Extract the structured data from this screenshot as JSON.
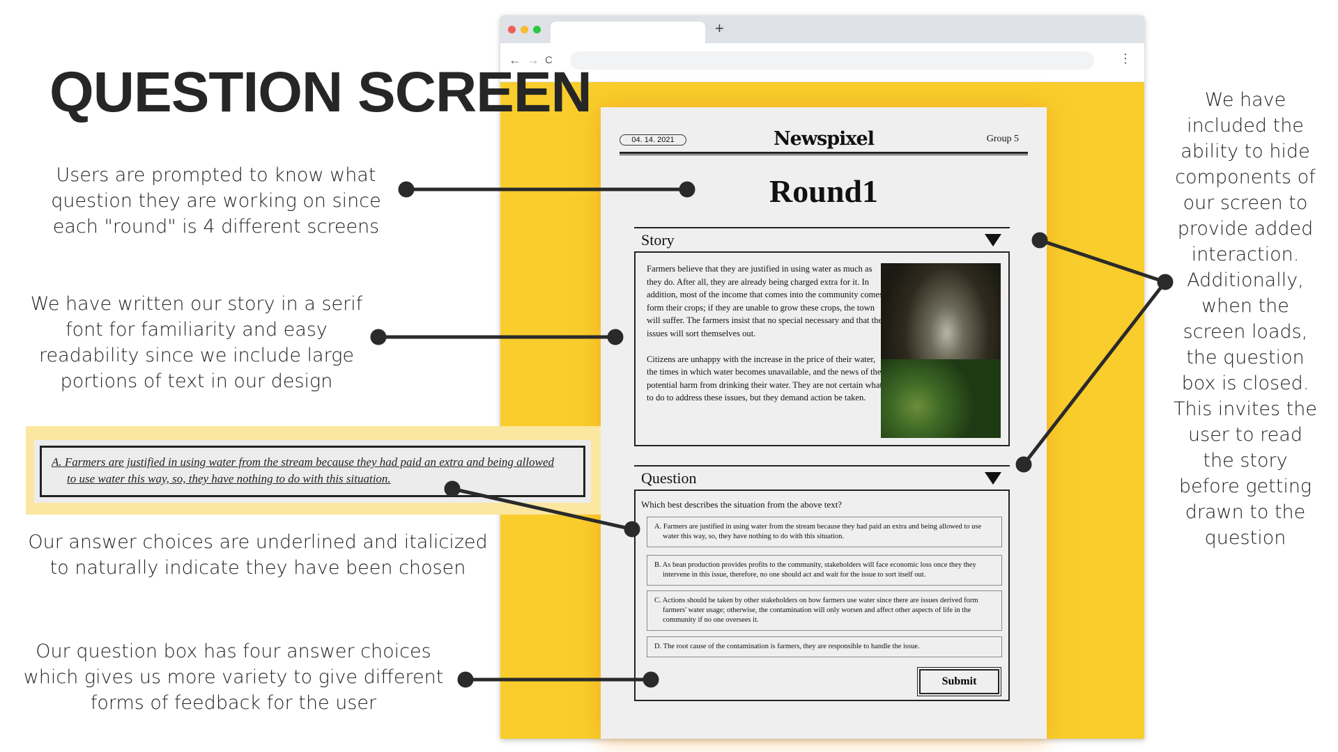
{
  "title": "QUESTION SCREEN",
  "annotations": {
    "round": "Users are prompted to know what question they are working on since each \"round\" is 4 different screens",
    "serif": "We have written our story in a serif font for familiarity and easy readability since we include large portions of text in our design",
    "underline": "Our answer choices are underlined and italicized to naturally indicate they have been chosen",
    "four_choices": "Our question box has four answer choices which gives us more variety to give different forms of feedback for the user",
    "hide": "We have included the ability to hide components of our screen to provide added interaction. Additionally, when the screen loads, the question box is closed. This invites the user to read the story before getting drawn to the question"
  },
  "selected_example": {
    "line1": "A. Farmers are justified in using water from the stream because they had paid an extra and being allowed",
    "line2": "to use water this way, so, they have nothing to do with this situation."
  },
  "browser": {
    "new_tab": "+",
    "back": "←",
    "forward": "→",
    "reload": "C",
    "menu": "⋮",
    "dot_colors": [
      "#ee5f57",
      "#f5bd2f",
      "#28c841"
    ]
  },
  "paper": {
    "date": "04. 14. 2021",
    "brand": "Newspixel",
    "group": "Group 5",
    "round": "Round1",
    "story": {
      "label": "Story",
      "paragraphs": [
        "Farmers believe that they are justified in using water as much as they do. After all, they are already being charged extra for it. In addition, most of the income that comes into the community comes form their crops; if they are unable to grow these crops, the town will suffer. The farmers insist that no special necessary and that the issues will sort themselves out.",
        "Citizens are unhappy with the increase in the price of their water, the times in which water becomes unavailable, and the news of the potential harm from drinking their water. They are not certain what to do to address these issues, but they demand action be taken."
      ]
    },
    "question": {
      "label": "Question",
      "prompt": "Which best describes the situation from the above text?",
      "choices": [
        "A. Farmers are justified in using water from the stream because they had paid an extra and being allowed to use water this way, so, they have nothing to do with this situation.",
        "B. As bean production provides profits to the community, stakeholders will face economic loss once they they intervene in this issue, therefore, no one should act and wait for the issue to sort itself out.",
        "C. Actions should be taken by other stakeholders on how farmers use water since there are issues derived form farmers' water usage; otherwise, the contamination will only worsen and affect other aspects of life in the community if no one oversees it.",
        "D. The root cause of the contamination is farmers, they are responsible to handle the issue."
      ],
      "submit": "Submit"
    }
  }
}
